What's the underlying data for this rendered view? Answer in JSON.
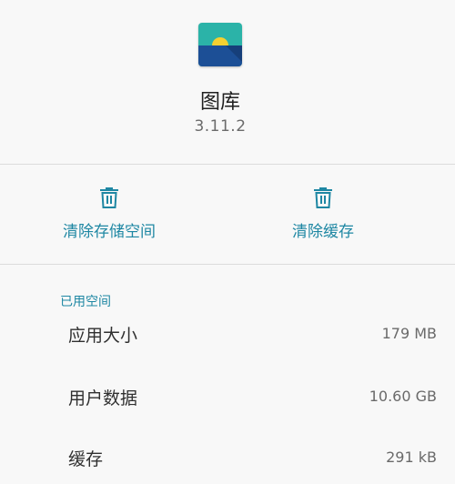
{
  "app": {
    "name": "图库",
    "version": "3.11.2"
  },
  "actions": {
    "clear_storage": {
      "label": "清除存储空间",
      "icon": "trash-icon"
    },
    "clear_cache": {
      "label": "清除缓存",
      "icon": "trash-icon"
    }
  },
  "storage": {
    "title": "已用空间",
    "rows": [
      {
        "label": "应用大小",
        "value": "179 MB"
      },
      {
        "label": "用户数据",
        "value": "10.60 GB"
      },
      {
        "label": "缓存",
        "value": "291 kB"
      }
    ]
  },
  "colors": {
    "accent": "#1e87a3",
    "icon_sky": "#2bb3a8",
    "icon_sun": "#f5d030",
    "icon_sea": "#1c4f96"
  }
}
